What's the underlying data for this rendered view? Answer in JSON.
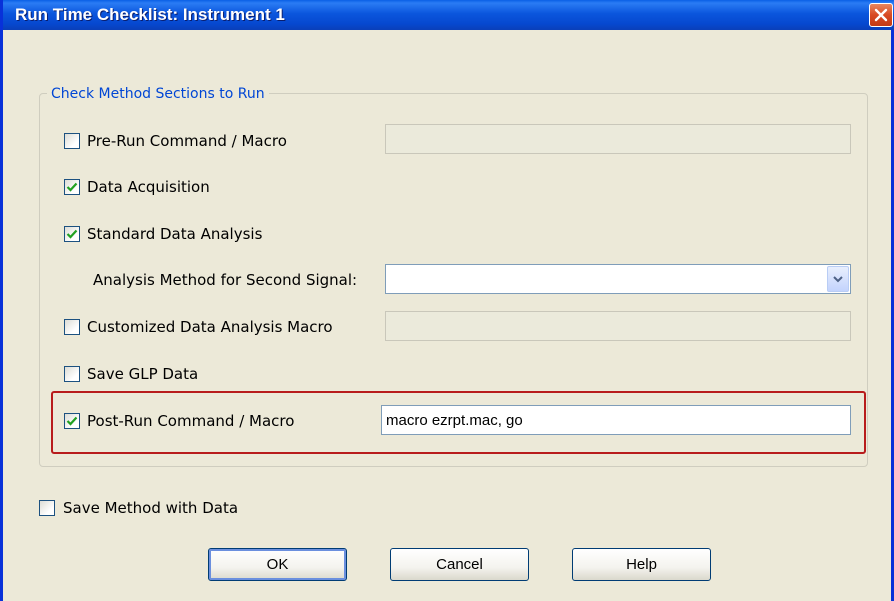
{
  "window": {
    "title": "Run Time Checklist: Instrument 1"
  },
  "group": {
    "legend": "Check Method Sections to Run"
  },
  "options": {
    "pre_run": {
      "label": "Pre-Run Command / Macro",
      "checked": false,
      "value": ""
    },
    "data_acquisition": {
      "label": "Data Acquisition",
      "checked": true
    },
    "standard_analysis": {
      "label": "Standard Data Analysis",
      "checked": true
    },
    "second_signal": {
      "label": "Analysis Method for Second Signal:",
      "value": ""
    },
    "custom_macro": {
      "label": "Customized Data Analysis Macro",
      "checked": false,
      "value": ""
    },
    "save_glp": {
      "label": "Save GLP Data",
      "checked": false
    },
    "post_run": {
      "label": "Post-Run Command / Macro",
      "checked": true,
      "value": "macro ezrpt.mac, go"
    }
  },
  "save_method": {
    "label": "Save Method with Data",
    "checked": false
  },
  "buttons": {
    "ok": "OK",
    "cancel": "Cancel",
    "help": "Help"
  },
  "colors": {
    "title_bar": "#0a5fe6",
    "highlight": "#b81c1c",
    "legend_text": "#0046d5",
    "check_mark": "#21a121"
  }
}
